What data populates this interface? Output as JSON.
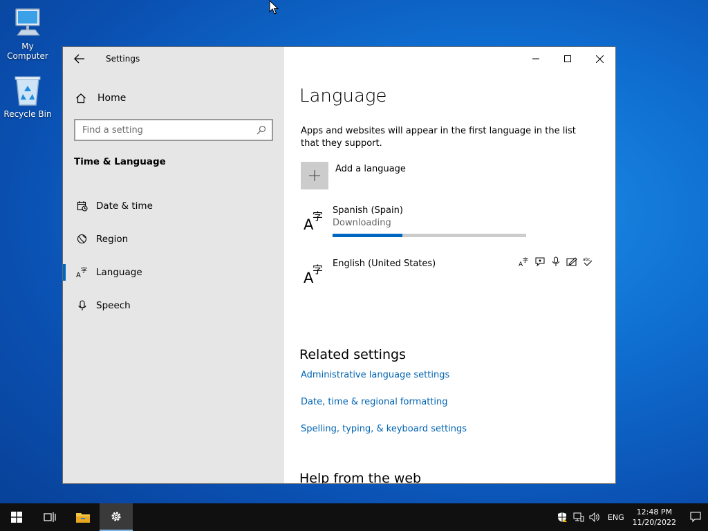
{
  "desktop": {
    "icons": [
      {
        "label": "My Computer"
      },
      {
        "label": "Recycle Bin"
      }
    ]
  },
  "window": {
    "title": "Settings"
  },
  "sidebar": {
    "home_label": "Home",
    "search_placeholder": "Find a setting",
    "section_title": "Time & Language",
    "items": [
      {
        "label": "Date & time",
        "icon": "calendar-clock-icon"
      },
      {
        "label": "Region",
        "icon": "globe-icon"
      },
      {
        "label": "Language",
        "icon": "language-icon",
        "active": true
      },
      {
        "label": "Speech",
        "icon": "microphone-icon"
      }
    ]
  },
  "main": {
    "title": "Language",
    "description": "Apps and websites will appear in the first language in the list that they support.",
    "add_language_label": "Add a language",
    "languages": [
      {
        "name": "Spanish (Spain)",
        "status": "Downloading",
        "progress": 0.36
      },
      {
        "name": "English (United States)"
      }
    ],
    "related_title": "Related settings",
    "related_links": [
      "Administrative language settings",
      "Date, time & regional formatting",
      "Spelling, typing, & keyboard settings"
    ],
    "help_title": "Help from the web"
  },
  "taskbar": {
    "input_language": "ENG",
    "time": "12:48 PM",
    "date": "11/20/2022"
  },
  "colors": {
    "accent": "#0067c0",
    "link": "#0063b1",
    "sidebar_bg": "#e6e6e6",
    "taskbar_bg": "#101010"
  }
}
